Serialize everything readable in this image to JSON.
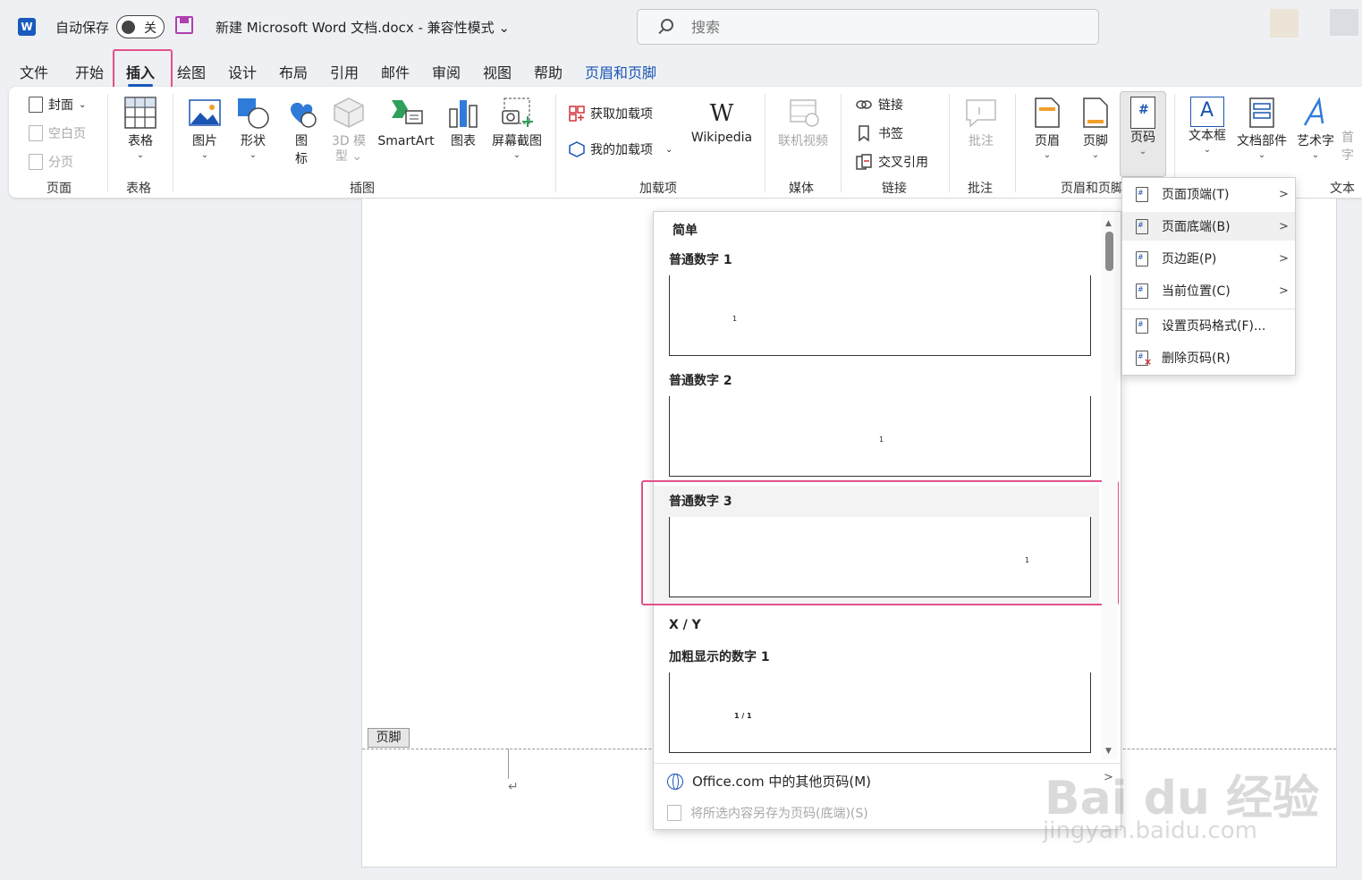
{
  "titlebar": {
    "app_icon": "W",
    "autosave_label": "自动保存",
    "autosave_state": "关",
    "doc_title": "新建 Microsoft Word 文档.docx  -  兼容性模式 ⌄",
    "search_placeholder": "搜索"
  },
  "menu_tabs": [
    "文件",
    "开始",
    "插入",
    "绘图",
    "设计",
    "布局",
    "引用",
    "邮件",
    "审阅",
    "视图",
    "帮助",
    "页眉和页脚"
  ],
  "active_tab": "插入",
  "ribbon": {
    "pages_group": {
      "label": "页面",
      "cover": "封面",
      "blank": "空白页",
      "break": "分页"
    },
    "table_group": {
      "label": "表格",
      "table": "表格"
    },
    "illus_group": {
      "label": "插图",
      "picture": "图片",
      "shapes": "形状",
      "icons_1": "图",
      "icons_2": "标",
      "model_1": "3D 模",
      "model_2": "型",
      "smartart": "SmartArt",
      "chart": "图表",
      "screenshot": "屏幕截图"
    },
    "addins_group": {
      "label": "加载项",
      "get": "获取加载项",
      "mine": "我的加载项",
      "wiki_logo": "W",
      "wiki": "Wikipedia"
    },
    "media_group": {
      "label": "媒体",
      "video": "联机视频"
    },
    "links_group": {
      "label": "链接",
      "link": "链接",
      "bookmark": "书签",
      "xref": "交叉引用"
    },
    "comments_group": {
      "label": "批注",
      "comment": "批注"
    },
    "hf_group": {
      "label": "页眉和页脚",
      "header": "页眉",
      "footer": "页脚",
      "pagenum": "页码",
      "pagenum_glyph": "#"
    },
    "text_group": {
      "label": "文本",
      "textbox": "文本框",
      "textbox_glyph": "A",
      "parts": "文档部件",
      "wordart": "艺术字",
      "dropcap": "首字"
    }
  },
  "document": {
    "footer_tag": "页脚",
    "para_mark": "↵"
  },
  "gallery": {
    "section1": "简单",
    "items": [
      {
        "title": "普通数字 1",
        "preview": "1"
      },
      {
        "title": "普通数字 2",
        "preview": "1"
      },
      {
        "title": "普通数字 3",
        "preview": "1"
      }
    ],
    "section2": "X / Y",
    "item4": {
      "title": "加粗显示的数字 1",
      "preview": "1 / 1"
    },
    "more": "Office.com 中的其他页码(M)",
    "more_arrow": ">",
    "save": "将所选内容另存为页码(底端)(S)"
  },
  "submenu": {
    "items": [
      {
        "label": "页面顶端(T)",
        "arrow": ">"
      },
      {
        "label": "页面底端(B)",
        "arrow": ">"
      },
      {
        "label": "页边距(P)",
        "arrow": ">"
      },
      {
        "label": "当前位置(C)",
        "arrow": ">"
      },
      {
        "label": "设置页码格式(F)...",
        "arrow": ""
      },
      {
        "label": "删除页码(R)",
        "arrow": ""
      }
    ]
  },
  "watermark": {
    "brand": "Bai du 经验",
    "url": "jingyan.baidu.com"
  },
  "colors": {
    "accent": "#185abd",
    "highlight": "#e2518a",
    "tab_blue": "#1a55b4"
  }
}
